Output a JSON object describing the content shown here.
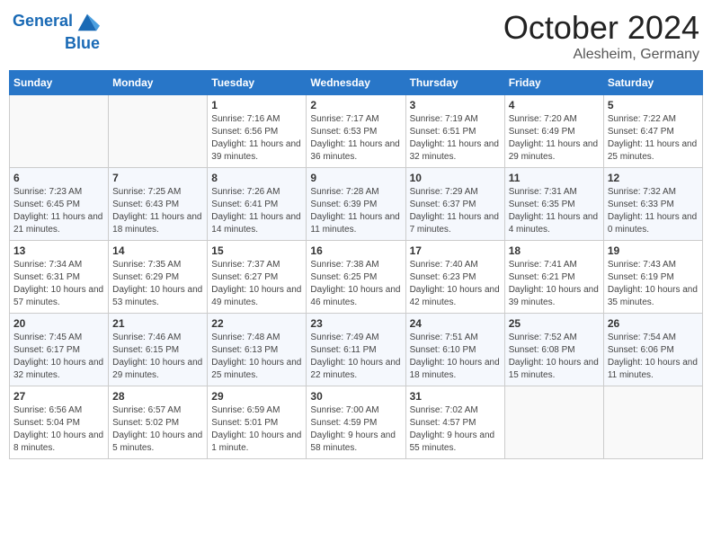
{
  "header": {
    "logo_line1": "General",
    "logo_line2": "Blue",
    "month": "October 2024",
    "location": "Alesheim, Germany"
  },
  "weekdays": [
    "Sunday",
    "Monday",
    "Tuesday",
    "Wednesday",
    "Thursday",
    "Friday",
    "Saturday"
  ],
  "weeks": [
    [
      {
        "day": "",
        "info": ""
      },
      {
        "day": "",
        "info": ""
      },
      {
        "day": "1",
        "info": "Sunrise: 7:16 AM\nSunset: 6:56 PM\nDaylight: 11 hours and 39 minutes."
      },
      {
        "day": "2",
        "info": "Sunrise: 7:17 AM\nSunset: 6:53 PM\nDaylight: 11 hours and 36 minutes."
      },
      {
        "day": "3",
        "info": "Sunrise: 7:19 AM\nSunset: 6:51 PM\nDaylight: 11 hours and 32 minutes."
      },
      {
        "day": "4",
        "info": "Sunrise: 7:20 AM\nSunset: 6:49 PM\nDaylight: 11 hours and 29 minutes."
      },
      {
        "day": "5",
        "info": "Sunrise: 7:22 AM\nSunset: 6:47 PM\nDaylight: 11 hours and 25 minutes."
      }
    ],
    [
      {
        "day": "6",
        "info": "Sunrise: 7:23 AM\nSunset: 6:45 PM\nDaylight: 11 hours and 21 minutes."
      },
      {
        "day": "7",
        "info": "Sunrise: 7:25 AM\nSunset: 6:43 PM\nDaylight: 11 hours and 18 minutes."
      },
      {
        "day": "8",
        "info": "Sunrise: 7:26 AM\nSunset: 6:41 PM\nDaylight: 11 hours and 14 minutes."
      },
      {
        "day": "9",
        "info": "Sunrise: 7:28 AM\nSunset: 6:39 PM\nDaylight: 11 hours and 11 minutes."
      },
      {
        "day": "10",
        "info": "Sunrise: 7:29 AM\nSunset: 6:37 PM\nDaylight: 11 hours and 7 minutes."
      },
      {
        "day": "11",
        "info": "Sunrise: 7:31 AM\nSunset: 6:35 PM\nDaylight: 11 hours and 4 minutes."
      },
      {
        "day": "12",
        "info": "Sunrise: 7:32 AM\nSunset: 6:33 PM\nDaylight: 11 hours and 0 minutes."
      }
    ],
    [
      {
        "day": "13",
        "info": "Sunrise: 7:34 AM\nSunset: 6:31 PM\nDaylight: 10 hours and 57 minutes."
      },
      {
        "day": "14",
        "info": "Sunrise: 7:35 AM\nSunset: 6:29 PM\nDaylight: 10 hours and 53 minutes."
      },
      {
        "day": "15",
        "info": "Sunrise: 7:37 AM\nSunset: 6:27 PM\nDaylight: 10 hours and 49 minutes."
      },
      {
        "day": "16",
        "info": "Sunrise: 7:38 AM\nSunset: 6:25 PM\nDaylight: 10 hours and 46 minutes."
      },
      {
        "day": "17",
        "info": "Sunrise: 7:40 AM\nSunset: 6:23 PM\nDaylight: 10 hours and 42 minutes."
      },
      {
        "day": "18",
        "info": "Sunrise: 7:41 AM\nSunset: 6:21 PM\nDaylight: 10 hours and 39 minutes."
      },
      {
        "day": "19",
        "info": "Sunrise: 7:43 AM\nSunset: 6:19 PM\nDaylight: 10 hours and 35 minutes."
      }
    ],
    [
      {
        "day": "20",
        "info": "Sunrise: 7:45 AM\nSunset: 6:17 PM\nDaylight: 10 hours and 32 minutes."
      },
      {
        "day": "21",
        "info": "Sunrise: 7:46 AM\nSunset: 6:15 PM\nDaylight: 10 hours and 29 minutes."
      },
      {
        "day": "22",
        "info": "Sunrise: 7:48 AM\nSunset: 6:13 PM\nDaylight: 10 hours and 25 minutes."
      },
      {
        "day": "23",
        "info": "Sunrise: 7:49 AM\nSunset: 6:11 PM\nDaylight: 10 hours and 22 minutes."
      },
      {
        "day": "24",
        "info": "Sunrise: 7:51 AM\nSunset: 6:10 PM\nDaylight: 10 hours and 18 minutes."
      },
      {
        "day": "25",
        "info": "Sunrise: 7:52 AM\nSunset: 6:08 PM\nDaylight: 10 hours and 15 minutes."
      },
      {
        "day": "26",
        "info": "Sunrise: 7:54 AM\nSunset: 6:06 PM\nDaylight: 10 hours and 11 minutes."
      }
    ],
    [
      {
        "day": "27",
        "info": "Sunrise: 6:56 AM\nSunset: 5:04 PM\nDaylight: 10 hours and 8 minutes."
      },
      {
        "day": "28",
        "info": "Sunrise: 6:57 AM\nSunset: 5:02 PM\nDaylight: 10 hours and 5 minutes."
      },
      {
        "day": "29",
        "info": "Sunrise: 6:59 AM\nSunset: 5:01 PM\nDaylight: 10 hours and 1 minute."
      },
      {
        "day": "30",
        "info": "Sunrise: 7:00 AM\nSunset: 4:59 PM\nDaylight: 9 hours and 58 minutes."
      },
      {
        "day": "31",
        "info": "Sunrise: 7:02 AM\nSunset: 4:57 PM\nDaylight: 9 hours and 55 minutes."
      },
      {
        "day": "",
        "info": ""
      },
      {
        "day": "",
        "info": ""
      }
    ]
  ]
}
